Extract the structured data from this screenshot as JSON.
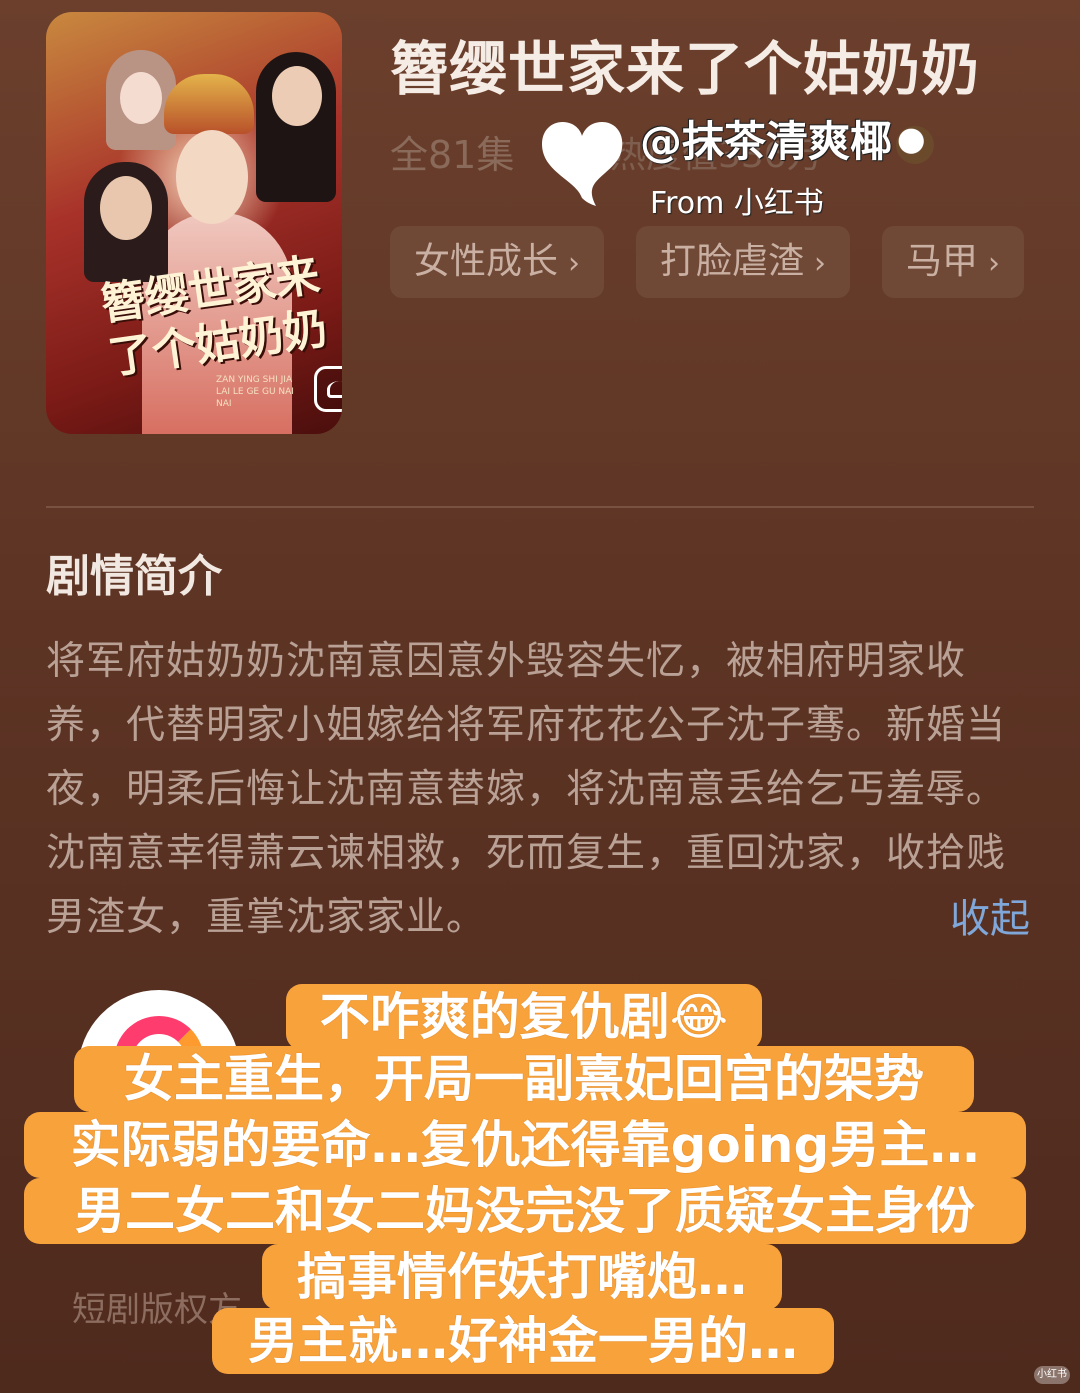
{
  "drama": {
    "title": "簪缨世家来了个姑奶奶",
    "episodes": "全81集",
    "heat_partial": "热度值336万",
    "poster_calligraphy": "簪缨世家来了个姑奶奶",
    "poster_subtitle": "ZAN YING SHI JIA LAI LE GE GU NAI NAI"
  },
  "tags": [
    {
      "label": "女性成长",
      "chevron": "›"
    },
    {
      "label": "打脸虐渣",
      "chevron": "›"
    },
    {
      "label": "马甲",
      "chevron": "›"
    }
  ],
  "synopsis": {
    "heading": "剧情简介",
    "text": "将军府姑奶奶沈南意因意外毁容失忆，被相府明家收养，代替明家小姐嫁给将军府花花公子沈子骞。新婚当夜，明柔后悔让沈南意替嫁，将沈南意丢给乞丐羞辱。沈南意幸得萧云谏相救，死而复生，重回沈家，收拾贱男渣女，重掌沈家家业。",
    "collapse_label": "收起"
  },
  "publisher": {
    "copyright_partial": "短剧版权方"
  },
  "watermark": {
    "handle": "@抹茶清爽椰",
    "from": "From 小红书"
  },
  "review_overlay": [
    "不咋爽的复仇剧😂",
    "女主重生，开局一副熹妃回宫的架势",
    "实际弱的要命…复仇还得靠going男主…",
    "男二女二和女二妈没完没了质疑女主身份",
    "搞事情作妖打嘴炮…",
    "男主就…好神金一男的…"
  ],
  "corner_badge": "小红书",
  "colors": {
    "background": "#5d3424",
    "tag_bg": "#6f4836",
    "overlay_orange": "#f8a23b",
    "link_blue": "#7fa7d9"
  }
}
